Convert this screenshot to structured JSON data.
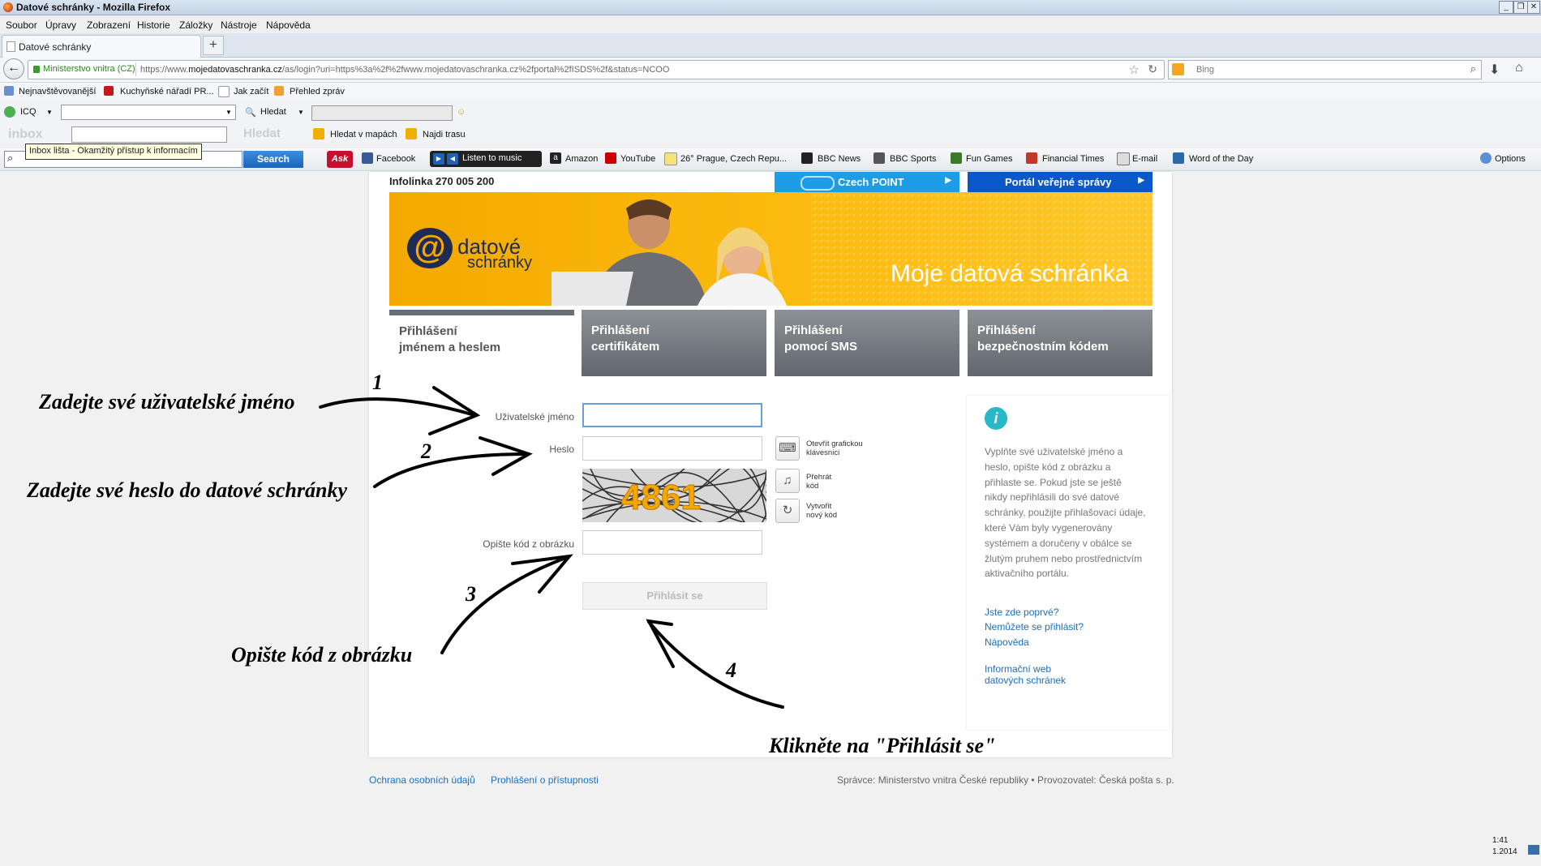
{
  "window": {
    "title": "Datové schránky - Mozilla Firefox"
  },
  "menu": [
    "Soubor",
    "Úpravy",
    "Zobrazení",
    "Historie",
    "Záložky",
    "Nástroje",
    "Nápověda"
  ],
  "tab": {
    "label": "Datové schránky",
    "new_tab": "+"
  },
  "nav": {
    "identity": "Ministerstvo vnitra (CZ)",
    "url_prefix": "https://www.",
    "url_host": "mojedatovaschranka.cz",
    "url_path": "/as/login?uri=https%3a%2f%2fwww.mojedatovaschranka.cz%2fportal%2fISDS%2f&status=NCOO",
    "search_placeholder": "Bing"
  },
  "bookmarks": [
    "Nejnavštěvovanější",
    "Kuchyňské nářadí PR...",
    "Jak začít",
    "Přehled zpráv"
  ],
  "icq": {
    "label": "ICQ",
    "search": "Hledat"
  },
  "inbox": {
    "logo": "inbox",
    "search": "Hledat",
    "maps": "Hledat v mapách",
    "route": "Najdi trasu",
    "tooltip": "Inbox lišta - Okamžitý přístup k informacím"
  },
  "asktoolbar": {
    "search_btn": "Search",
    "items": [
      "Facebook",
      "Listen to music",
      "Amazon",
      "YouTube",
      "26° Prague, Czech Repu...",
      "BBC News",
      "BBC Sports",
      "Fun Games",
      "Financial Times",
      "E-mail",
      "Word of the Day"
    ],
    "options": "Options"
  },
  "page": {
    "infolinka": "Infolinka 270 005 200",
    "czpoint": "Czech POINT",
    "portal": "Portál veřejné správy",
    "arrow": "▶",
    "banner_brand1": "datové",
    "banner_brand2": "schránky",
    "banner_title": "Moje datová schránka",
    "tabs": [
      {
        "line1": "Přihlášení",
        "line2": "jménem a heslem"
      },
      {
        "line1": "Přihlášení",
        "line2": "certifikátem"
      },
      {
        "line1": "Přihlášení",
        "line2": "pomocí SMS"
      },
      {
        "line1": "Přihlášení",
        "line2": "bezpečnostním kódem"
      }
    ],
    "form": {
      "username_label": "Uživatelské jméno",
      "password_label": "Heslo",
      "captcha_label": "Opište kód z obrázku",
      "captcha_text": "4861",
      "keyboard_line1": "Otevřít grafickou",
      "keyboard_line2": "klávesnici",
      "play_line1": "Přehrát",
      "play_line2": "kód",
      "new_line1": "Vytvořit",
      "new_line2": "nový kód",
      "login_button": "Přihlásit se"
    },
    "info": {
      "text": "Vyplňte své uživatelské jméno a heslo, opište kód z obrázku a přihlaste se. Pokud jste se ještě nikdy nepřihlásili do své datové schránky, použijte přihlašovací údaje, které Vám byly vygenerovány systémem a doručeny v obálce se žlutým pruhem nebo prostřednictvím aktivačního portálu.",
      "link1": "Jste zde poprvé?",
      "link2": "Nemůžete se přihlásit?",
      "link3": "Nápověda",
      "link4a": "Informační web",
      "link4b": "datových schránek"
    },
    "footer": {
      "privacy": "Ochrana osobních údajů",
      "accessibility": "Prohlášení o přístupnosti",
      "operator": "Správce: Ministerstvo vnitra České republiky • Provozovatel: Česká pošta s. p."
    }
  },
  "annotations": {
    "a1": "Zadejte své uživatelské jméno",
    "a2": "Zadejte své heslo do datové schránky",
    "a3": "Opište kód z obrázku",
    "a4": "Klikněte na \"Přihlásit se\"",
    "n1": "1",
    "n2": "2",
    "n3": "3",
    "n4": "4"
  },
  "clock": {
    "time": "1:41",
    "date": "1.2014"
  }
}
